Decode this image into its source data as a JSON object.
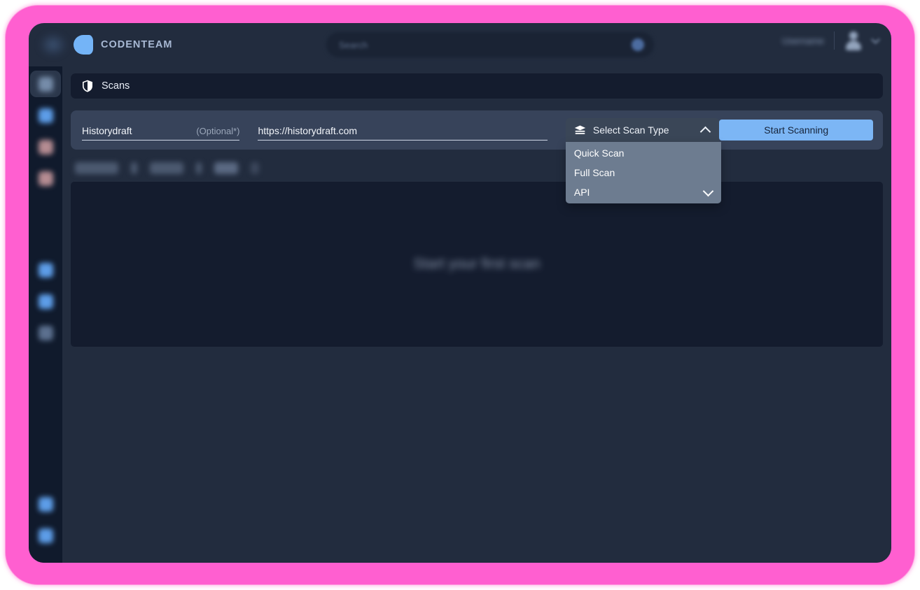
{
  "frame": {
    "accent_color": "#ff5fd0"
  },
  "topbar": {
    "menu_icon": "hamburger-icon",
    "logo_icon": "codenteam-logo-icon",
    "brand": "CODENTEAM",
    "search": {
      "placeholder": "Search",
      "value": "",
      "icon": "search-icon"
    },
    "user": {
      "name": "Username",
      "avatar_icon": "user-avatar-icon",
      "caret_icon": "chevron-down-icon"
    }
  },
  "sidebar": {
    "items": [
      {
        "name": "sidebar-item-dashboard",
        "icon": "grid-icon",
        "active": true
      },
      {
        "name": "sidebar-item-scans",
        "icon": "shield-icon",
        "active": false
      },
      {
        "name": "sidebar-item-reports",
        "icon": "document-icon",
        "active": false
      },
      {
        "name": "sidebar-item-projects",
        "icon": "folder-icon",
        "active": false
      },
      {
        "name": "sidebar-item-analytics",
        "icon": "chart-icon",
        "active": false
      },
      {
        "name": "sidebar-item-integrations",
        "icon": "plug-icon",
        "active": false
      },
      {
        "name": "sidebar-item-team",
        "icon": "users-icon",
        "active": false
      },
      {
        "name": "sidebar-item-settings",
        "icon": "gear-icon",
        "active": false
      },
      {
        "name": "sidebar-item-help",
        "icon": "help-icon",
        "active": false
      }
    ]
  },
  "page": {
    "title": "Scans",
    "title_icon": "shield-icon"
  },
  "scan_form": {
    "project_name": {
      "value": "Historydraft",
      "optional_label": "(Optional*)"
    },
    "url": {
      "value": "https://historydraft.com"
    },
    "scan_type": {
      "label": "Select Scan Type",
      "icon": "layers-icon",
      "expanded": true,
      "toggle_icon": "chevron-up-icon",
      "scroll_icon": "chevron-down-icon",
      "options": [
        "Quick Scan",
        "Full Scan",
        "API"
      ]
    },
    "start_button": "Start Scanning"
  },
  "filters": {
    "items": [
      "All Scans",
      "Status",
      "Date",
      "Sort"
    ]
  },
  "empty_state": {
    "message": "Start your first scan"
  }
}
